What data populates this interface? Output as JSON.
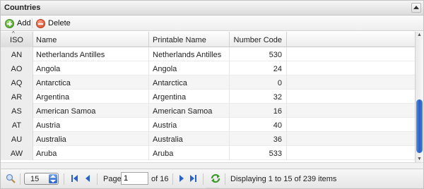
{
  "panel": {
    "title": "Countries"
  },
  "toolbar": {
    "add_label": "Add",
    "delete_label": "Delete"
  },
  "columns": {
    "iso": "ISO",
    "name": "Name",
    "printable_name": "Printable Name",
    "number_code": "Number Code"
  },
  "rows": [
    {
      "iso": "AN",
      "name": "Netherlands Antilles",
      "printable_name": "Netherlands Antilles",
      "number_code": "530"
    },
    {
      "iso": "AO",
      "name": "Angola",
      "printable_name": "Angola",
      "number_code": "24"
    },
    {
      "iso": "AQ",
      "name": "Antarctica",
      "printable_name": "Antarctica",
      "number_code": "0"
    },
    {
      "iso": "AR",
      "name": "Argentina",
      "printable_name": "Argentina",
      "number_code": "32"
    },
    {
      "iso": "AS",
      "name": "American Samoa",
      "printable_name": "American Samoa",
      "number_code": "16"
    },
    {
      "iso": "AT",
      "name": "Austria",
      "printable_name": "Austria",
      "number_code": "40"
    },
    {
      "iso": "AU",
      "name": "Australia",
      "printable_name": "Australia",
      "number_code": "36"
    },
    {
      "iso": "AW",
      "name": "Aruba",
      "printable_name": "Aruba",
      "number_code": "533"
    }
  ],
  "pager": {
    "page_size": "15",
    "page_label": "Page",
    "current_page": "1",
    "of_label": "of 16",
    "status": "Displaying 1 to 15 of 239 items"
  },
  "icons": {
    "add": "add-icon",
    "delete": "delete-icon",
    "search": "search-icon",
    "first": "first-page-icon",
    "prev": "prev-page-icon",
    "next": "next-page-icon",
    "last": "last-page-icon",
    "refresh": "refresh-icon"
  },
  "colors": {
    "accent": "#2a5fc4",
    "add": "#3d9a1c",
    "delete": "#d23f1c"
  }
}
